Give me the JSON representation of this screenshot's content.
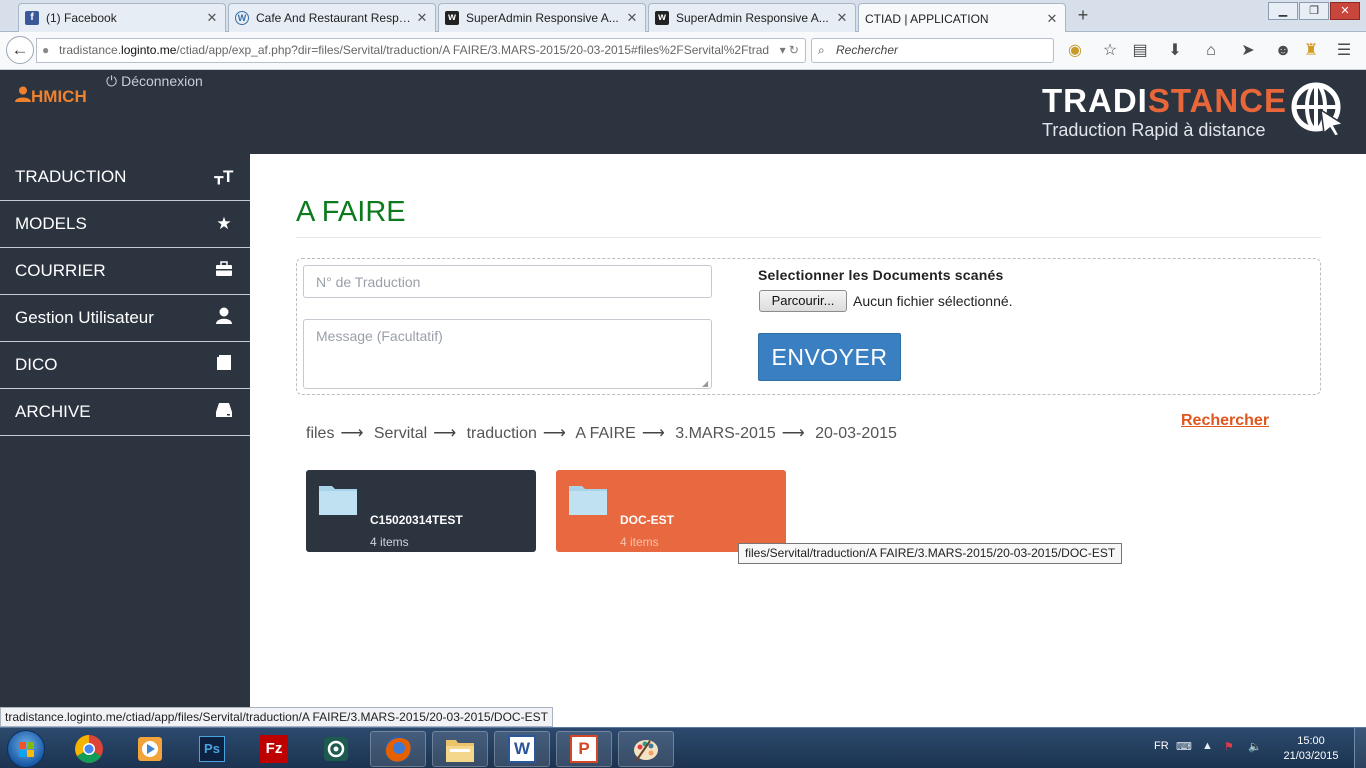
{
  "browser": {
    "tabs": [
      {
        "title": "(1) Facebook",
        "icon": "facebook-icon",
        "active": false
      },
      {
        "title": "Cafe And Restaurant Respo...",
        "icon": "wordpress-icon",
        "active": false
      },
      {
        "title": "SuperAdmin Responsive A...",
        "icon": "w-app-icon",
        "active": false
      },
      {
        "title": "SuperAdmin Responsive A...",
        "icon": "w-app-icon",
        "active": false
      },
      {
        "title": "CTIAD | APPLICATION",
        "icon": "none",
        "active": true
      }
    ],
    "url_prefix": "tradistance.",
    "url_domain": "loginto.me",
    "url_path": "/ctiad/app/exp_af.php?dir=files/Servital/traduction/A FAIRE/3.MARS-2015/20-03-2015#files%2FServital%2Ftrad",
    "search_placeholder": "Rechercher",
    "status_url": "tradistance.loginto.me/ctiad/app/files/Servital/traduction/A FAIRE/3.MARS-2015/20-03-2015/DOC-EST"
  },
  "header": {
    "username": "HMICH",
    "logout_label": "Déconnexion",
    "logo_main": "TRADI",
    "logo_accent": "STANCE",
    "logo_tagline": "Traduction Rapid à distance"
  },
  "sidebar": {
    "items": [
      {
        "label": "TRADUCTION",
        "icon": "text-height-icon"
      },
      {
        "label": "MODELS",
        "icon": "star-icon"
      },
      {
        "label": "COURRIER",
        "icon": "briefcase-icon"
      },
      {
        "label": "Gestion Utilisateur",
        "icon": "user-icon"
      },
      {
        "label": "DICO",
        "icon": "book-icon"
      },
      {
        "label": "ARCHIVE",
        "icon": "hdd-icon"
      }
    ]
  },
  "main": {
    "title": "A FAIRE",
    "form": {
      "num_placeholder": "N° de Traduction",
      "message_placeholder": "Message (Facultatif)",
      "select_label": "Selectionner les Documents scanés",
      "browse_label": "Parcourir...",
      "file_status": "Aucun fichier sélectionné.",
      "send_label": "ENVOYER"
    },
    "breadcrumb": [
      "files",
      "Servital",
      "traduction",
      "A FAIRE",
      "3.MARS-2015",
      "20-03-2015"
    ],
    "breadcrumb_separator": "⟶",
    "search_link": "Rechercher",
    "folders": [
      {
        "name": "C15020314TEST",
        "count": "4 items",
        "color": "#2c3440"
      },
      {
        "name": "DOC-EST",
        "count": "4 items",
        "color": "#e8683f"
      }
    ],
    "tooltip": "files/Servital/traduction/A FAIRE/3.MARS-2015/20-03-2015/DOC-EST"
  },
  "taskbar": {
    "apps": [
      "chrome-icon",
      "media-player-icon",
      "photoshop-icon",
      "filezilla-icon",
      "app-icon",
      "firefox-icon",
      "explorer-icon",
      "word-icon",
      "powerpoint-icon",
      "paint-icon"
    ],
    "app_labels": {
      "photoshop": "Ps",
      "filezilla": "Fz",
      "word": "W",
      "powerpoint": "P"
    },
    "language": "FR",
    "time": "15:00",
    "date": "21/03/2015"
  },
  "colors": {
    "sidebar_bg": "#2c3440",
    "accent_orange": "#e8683f",
    "title_green": "#0d7a1d",
    "send_blue": "#3a7fc1",
    "username_orange": "#f0822e"
  }
}
